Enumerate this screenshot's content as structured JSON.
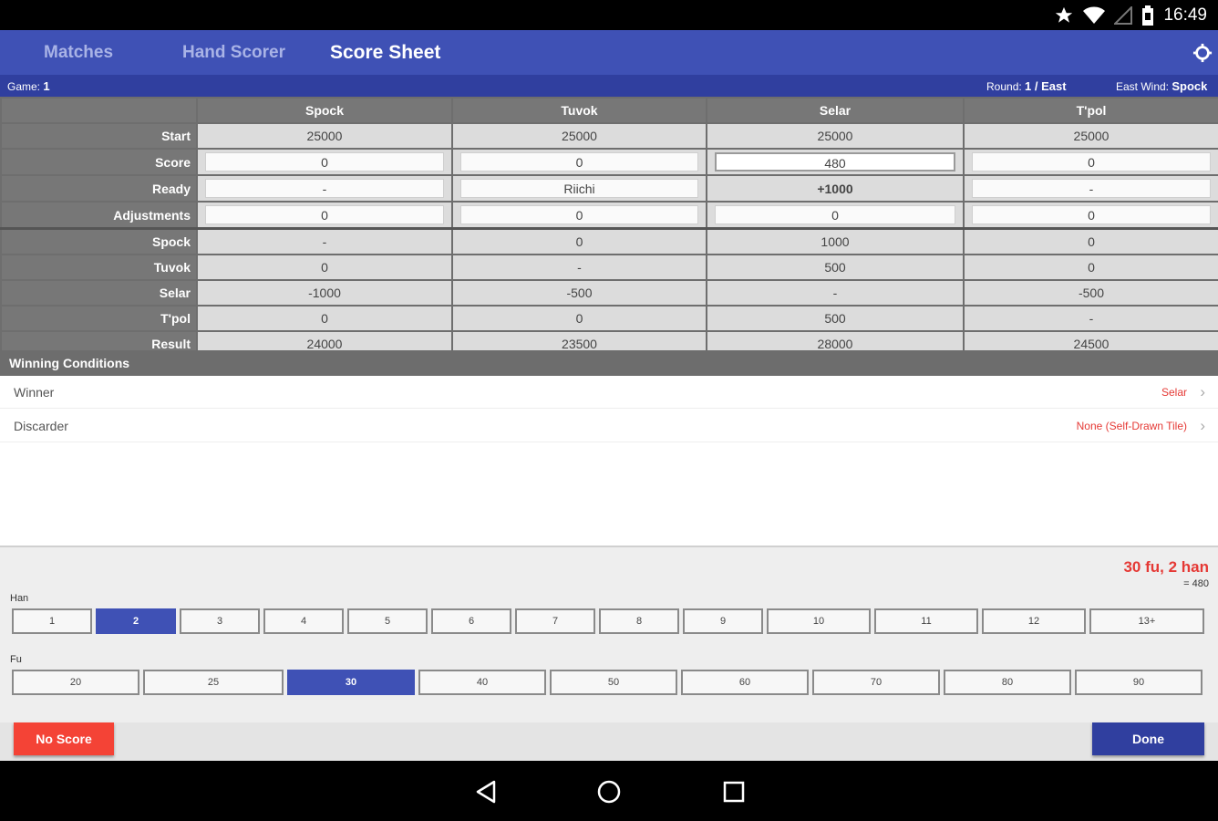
{
  "status_bar": {
    "time": "16:49",
    "icons": [
      "star-icon",
      "wifi-icon",
      "signal-icon",
      "battery-icon"
    ]
  },
  "app_bar": {
    "tabs": [
      {
        "label": "Matches",
        "active": false
      },
      {
        "label": "Hand Scorer",
        "active": false
      },
      {
        "label": "Score Sheet",
        "active": true
      }
    ],
    "settings_icon": "gear-icon"
  },
  "info_bar": {
    "game_label": "Game:",
    "game_value": "1",
    "round_label": "Round:",
    "round_value": "1 / East",
    "east_wind_label": "East Wind:",
    "east_wind_value": "Spock"
  },
  "score_table": {
    "players": [
      "Spock",
      "Tuvok",
      "Selar",
      "T'pol"
    ],
    "rows": [
      {
        "label": "Start",
        "values": [
          "25000",
          "25000",
          "25000",
          "25000"
        ]
      },
      {
        "label": "Score",
        "values": [
          "0",
          "0",
          "480",
          "0"
        ]
      },
      {
        "label": "Ready",
        "values": [
          "-",
          "Riichi",
          "+1000",
          "-"
        ]
      },
      {
        "label": "Adjustments",
        "values": [
          "0",
          "0",
          "0",
          "0"
        ]
      },
      {
        "label": "Spock",
        "values": [
          "-",
          "0",
          "1000",
          "0"
        ]
      },
      {
        "label": "Tuvok",
        "values": [
          "0",
          "-",
          "500",
          "0"
        ]
      },
      {
        "label": "Selar",
        "values": [
          "-1000",
          "-500",
          "-",
          "-500"
        ]
      },
      {
        "label": "T'pol",
        "values": [
          "0",
          "0",
          "500",
          "-"
        ]
      },
      {
        "label": "Result",
        "values": [
          "24000",
          "23500",
          "28000",
          "24500"
        ]
      }
    ]
  },
  "winning_conditions": {
    "title": "Winning Conditions",
    "winner_label": "Winner",
    "winner_value": "Selar",
    "discarder_label": "Discarder",
    "discarder_value": "None (Self-Drawn Tile)"
  },
  "scoring": {
    "summary": "30 fu, 2 han",
    "points": "= 480",
    "han_label": "Han",
    "han_options": [
      "1",
      "2",
      "3",
      "4",
      "5",
      "6",
      "7",
      "8",
      "9",
      "10",
      "11",
      "12",
      "13+"
    ],
    "han_selected": "2",
    "fu_label": "Fu",
    "fu_options": [
      "20",
      "25",
      "30",
      "40",
      "50",
      "60",
      "70",
      "80",
      "90"
    ],
    "fu_selected": "30"
  },
  "actions": {
    "no_score": "No Score",
    "done": "Done"
  },
  "colors": {
    "primary": "#3f51b5",
    "primary_dark": "#303f9f",
    "accent_red": "#f44336",
    "ready_green": "#2eaa2e"
  }
}
